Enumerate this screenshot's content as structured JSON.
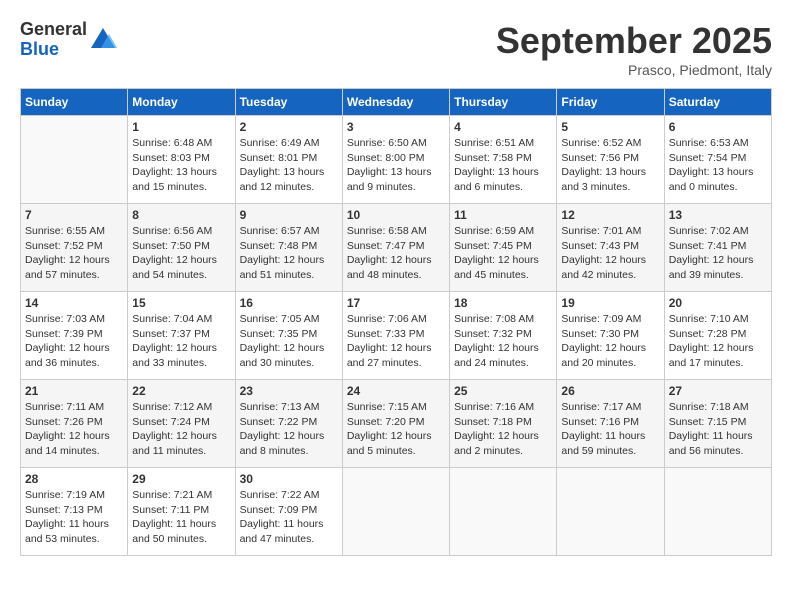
{
  "logo": {
    "general": "General",
    "blue": "Blue"
  },
  "header": {
    "month": "September 2025",
    "location": "Prasco, Piedmont, Italy"
  },
  "days_of_week": [
    "Sunday",
    "Monday",
    "Tuesday",
    "Wednesday",
    "Thursday",
    "Friday",
    "Saturday"
  ],
  "weeks": [
    [
      {
        "day": "",
        "details": ""
      },
      {
        "day": "1",
        "details": "Sunrise: 6:48 AM\nSunset: 8:03 PM\nDaylight: 13 hours\nand 15 minutes."
      },
      {
        "day": "2",
        "details": "Sunrise: 6:49 AM\nSunset: 8:01 PM\nDaylight: 13 hours\nand 12 minutes."
      },
      {
        "day": "3",
        "details": "Sunrise: 6:50 AM\nSunset: 8:00 PM\nDaylight: 13 hours\nand 9 minutes."
      },
      {
        "day": "4",
        "details": "Sunrise: 6:51 AM\nSunset: 7:58 PM\nDaylight: 13 hours\nand 6 minutes."
      },
      {
        "day": "5",
        "details": "Sunrise: 6:52 AM\nSunset: 7:56 PM\nDaylight: 13 hours\nand 3 minutes."
      },
      {
        "day": "6",
        "details": "Sunrise: 6:53 AM\nSunset: 7:54 PM\nDaylight: 13 hours\nand 0 minutes."
      }
    ],
    [
      {
        "day": "7",
        "details": "Sunrise: 6:55 AM\nSunset: 7:52 PM\nDaylight: 12 hours\nand 57 minutes."
      },
      {
        "day": "8",
        "details": "Sunrise: 6:56 AM\nSunset: 7:50 PM\nDaylight: 12 hours\nand 54 minutes."
      },
      {
        "day": "9",
        "details": "Sunrise: 6:57 AM\nSunset: 7:48 PM\nDaylight: 12 hours\nand 51 minutes."
      },
      {
        "day": "10",
        "details": "Sunrise: 6:58 AM\nSunset: 7:47 PM\nDaylight: 12 hours\nand 48 minutes."
      },
      {
        "day": "11",
        "details": "Sunrise: 6:59 AM\nSunset: 7:45 PM\nDaylight: 12 hours\nand 45 minutes."
      },
      {
        "day": "12",
        "details": "Sunrise: 7:01 AM\nSunset: 7:43 PM\nDaylight: 12 hours\nand 42 minutes."
      },
      {
        "day": "13",
        "details": "Sunrise: 7:02 AM\nSunset: 7:41 PM\nDaylight: 12 hours\nand 39 minutes."
      }
    ],
    [
      {
        "day": "14",
        "details": "Sunrise: 7:03 AM\nSunset: 7:39 PM\nDaylight: 12 hours\nand 36 minutes."
      },
      {
        "day": "15",
        "details": "Sunrise: 7:04 AM\nSunset: 7:37 PM\nDaylight: 12 hours\nand 33 minutes."
      },
      {
        "day": "16",
        "details": "Sunrise: 7:05 AM\nSunset: 7:35 PM\nDaylight: 12 hours\nand 30 minutes."
      },
      {
        "day": "17",
        "details": "Sunrise: 7:06 AM\nSunset: 7:33 PM\nDaylight: 12 hours\nand 27 minutes."
      },
      {
        "day": "18",
        "details": "Sunrise: 7:08 AM\nSunset: 7:32 PM\nDaylight: 12 hours\nand 24 minutes."
      },
      {
        "day": "19",
        "details": "Sunrise: 7:09 AM\nSunset: 7:30 PM\nDaylight: 12 hours\nand 20 minutes."
      },
      {
        "day": "20",
        "details": "Sunrise: 7:10 AM\nSunset: 7:28 PM\nDaylight: 12 hours\nand 17 minutes."
      }
    ],
    [
      {
        "day": "21",
        "details": "Sunrise: 7:11 AM\nSunset: 7:26 PM\nDaylight: 12 hours\nand 14 minutes."
      },
      {
        "day": "22",
        "details": "Sunrise: 7:12 AM\nSunset: 7:24 PM\nDaylight: 12 hours\nand 11 minutes."
      },
      {
        "day": "23",
        "details": "Sunrise: 7:13 AM\nSunset: 7:22 PM\nDaylight: 12 hours\nand 8 minutes."
      },
      {
        "day": "24",
        "details": "Sunrise: 7:15 AM\nSunset: 7:20 PM\nDaylight: 12 hours\nand 5 minutes."
      },
      {
        "day": "25",
        "details": "Sunrise: 7:16 AM\nSunset: 7:18 PM\nDaylight: 12 hours\nand 2 minutes."
      },
      {
        "day": "26",
        "details": "Sunrise: 7:17 AM\nSunset: 7:16 PM\nDaylight: 11 hours\nand 59 minutes."
      },
      {
        "day": "27",
        "details": "Sunrise: 7:18 AM\nSunset: 7:15 PM\nDaylight: 11 hours\nand 56 minutes."
      }
    ],
    [
      {
        "day": "28",
        "details": "Sunrise: 7:19 AM\nSunset: 7:13 PM\nDaylight: 11 hours\nand 53 minutes."
      },
      {
        "day": "29",
        "details": "Sunrise: 7:21 AM\nSunset: 7:11 PM\nDaylight: 11 hours\nand 50 minutes."
      },
      {
        "day": "30",
        "details": "Sunrise: 7:22 AM\nSunset: 7:09 PM\nDaylight: 11 hours\nand 47 minutes."
      },
      {
        "day": "",
        "details": ""
      },
      {
        "day": "",
        "details": ""
      },
      {
        "day": "",
        "details": ""
      },
      {
        "day": "",
        "details": ""
      }
    ]
  ]
}
